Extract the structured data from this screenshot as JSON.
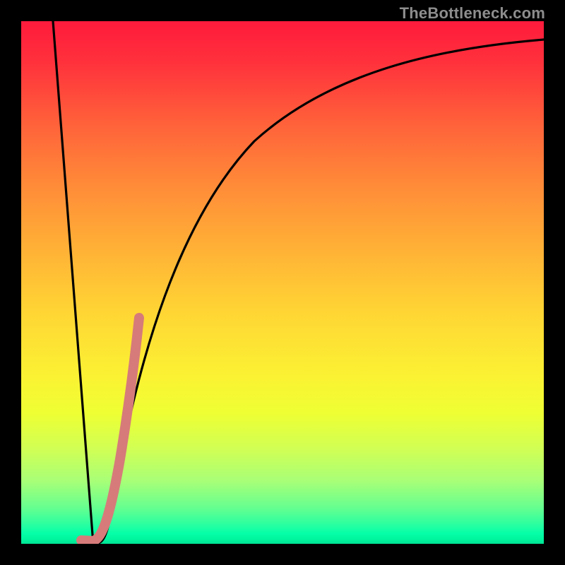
{
  "watermark": "TheBottleneck.com",
  "colors": {
    "background": "#000000",
    "curve": "#000000",
    "highlight": "#d67b7a",
    "watermark_text": "#8d8d8d"
  },
  "chart_data": {
    "type": "line",
    "title": "",
    "xlabel": "",
    "ylabel": "",
    "xlim": [
      0,
      100
    ],
    "ylim": [
      0,
      100
    ],
    "grid": false,
    "series": [
      {
        "name": "black-curve",
        "x": [
          0,
          4,
          8,
          12,
          12.5,
          13,
          14,
          16,
          18,
          20,
          22,
          24,
          27,
          30,
          34,
          38,
          42,
          46,
          50,
          55,
          60,
          66,
          72,
          78,
          84,
          90,
          95,
          100
        ],
        "y": [
          100,
          67,
          34,
          3,
          0.5,
          0,
          6,
          19,
          31,
          42,
          51,
          58,
          66,
          72,
          77,
          81,
          84,
          86.5,
          88.5,
          90.3,
          91.8,
          93,
          94,
          94.8,
          95.4,
          95.9,
          96.2,
          96.5
        ]
      },
      {
        "name": "highlight-segment",
        "x": [
          11,
          13,
          15.5,
          18,
          20,
          22
        ],
        "y": [
          0.5,
          0.5,
          8,
          22,
          35,
          48
        ]
      }
    ]
  }
}
